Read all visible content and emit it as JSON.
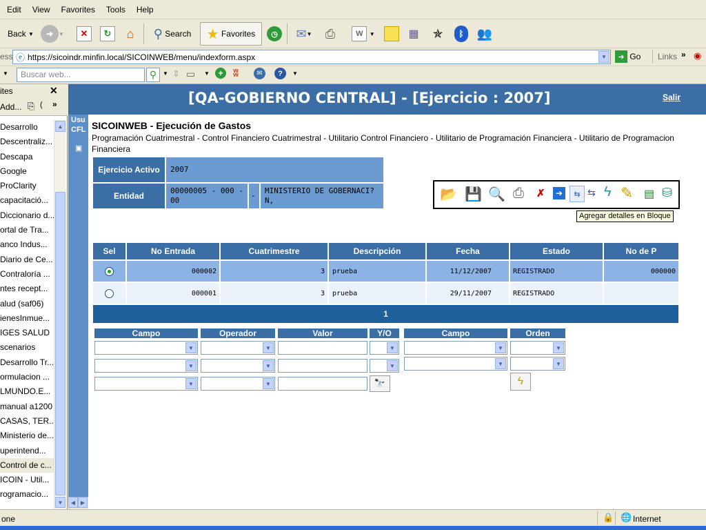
{
  "menu": {
    "items": [
      "Edit",
      "View",
      "Favorites",
      "Tools",
      "Help"
    ]
  },
  "toolbar": {
    "back_label": "Back",
    "search_label": "Search",
    "favorites_label": "Favorites"
  },
  "address": {
    "label": "ess",
    "url": "https://sicoindr.minfin.local/SICOINWEB/menu/indexform.aspx",
    "go_label": "Go",
    "links_label": "Links"
  },
  "searchbar": {
    "placeholder": "Buscar web..."
  },
  "favorites": {
    "title": "ites",
    "add_label": "Add...",
    "items": [
      "Desarrollo",
      "Descentraliz...",
      "Descapa",
      "Google",
      "ProClarity",
      "capacitació...",
      "Diccionario d...",
      "ortal de Tra...",
      "anco Indus...",
      "Diario de Ce...",
      "Contraloría ...",
      "ntes recept...",
      "alud (saf06)",
      "ienesInmue...",
      "IGES SALUD",
      "scenarios",
      "Desarrollo Tr...",
      "ormulacion ...",
      "LMUNDO.E...",
      "manual a1200",
      "CASAS, TER...",
      "Ministerio de...",
      "uperintend...",
      "Control de c...",
      "ICOIN - Util...",
      "rogramacio..."
    ],
    "selected_index": 23
  },
  "app": {
    "header_title": "[QA-GOBIERNO CENTRAL] - [Ejercicio : 2007]",
    "salir_label": "Salir",
    "side_user": "Usu",
    "side_user2": "CFL",
    "module_title": "SICOINWEB - Ejecución de Gastos",
    "breadcrumb": "Programación Cuatrimestral - Control Financiero Cuatrimestral - Utilitario Control Financiero - Utilitario de Programación Financiera - Utilitario de Programacion Financiera",
    "info": {
      "ejercicio_label": "Ejercicio Activo",
      "ejercicio_value": "2007",
      "entidad_label": "Entidad",
      "entidad_code": "00000005 - 000 - 00",
      "entidad_sep": "-",
      "entidad_name": "MINISTERIO DE GOBERNACI?N,"
    },
    "tooltip": "Agregar detalles en Bloque",
    "grid": {
      "headers": [
        "Sel",
        "No Entrada",
        "Cuatrimestre",
        "Descripción",
        "Fecha",
        "Estado",
        "No de P"
      ],
      "rows": [
        {
          "selected": true,
          "no_entrada": "000002",
          "cuatrimestre": "3",
          "descripcion": "prueba",
          "fecha": "11/12/2007",
          "estado": "REGISTRADO",
          "no_p": "000000"
        },
        {
          "selected": false,
          "no_entrada": "000001",
          "cuatrimestre": "3",
          "descripcion": "prueba",
          "fecha": "29/11/2007",
          "estado": "REGISTRADO",
          "no_p": ""
        }
      ],
      "page": "1"
    },
    "filters": {
      "headers": [
        "Campo",
        "Operador",
        "Valor",
        "Y/O",
        "Campo",
        "Orden"
      ]
    }
  },
  "status": {
    "left": "one",
    "zone": "Internet"
  }
}
